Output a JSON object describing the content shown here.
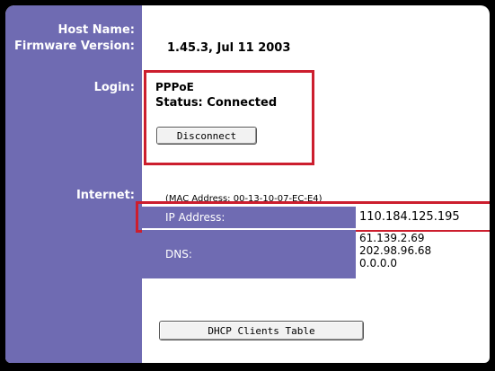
{
  "labels": {
    "host_name": "Host Name:",
    "firmware_version": "Firmware Version:",
    "login": "Login:",
    "internet": "Internet:"
  },
  "values": {
    "firmware_version": "1.45.3, Jul 11 2003",
    "login_type": "PPPoE",
    "login_status": "Status: Connected"
  },
  "buttons": {
    "disconnect": "Disconnect",
    "dhcp_clients": "DHCP Clients Table"
  },
  "internet": {
    "mac_address": "(MAC Address: 00-13-10-07-EC-E4)",
    "ip_label": "IP Address:",
    "ip_value": "110.184.125.195",
    "dns_label": "DNS:",
    "dns_values": [
      "61.139.2.69",
      "202.98.96.68",
      "0.0.0.0"
    ]
  },
  "colors": {
    "sidebar": "#6f6bb2",
    "highlight_box": "#cc1e2e"
  }
}
